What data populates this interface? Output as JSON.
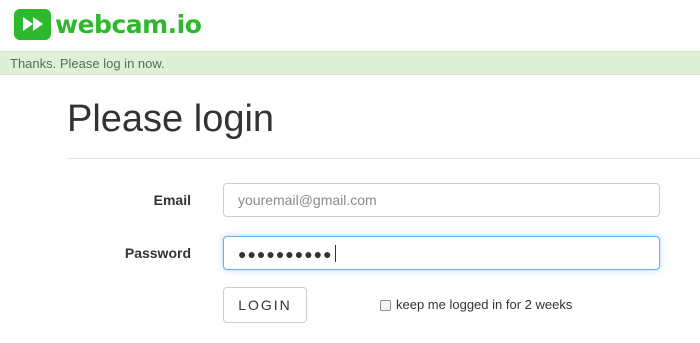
{
  "header": {
    "logo_text": "webcam.io",
    "logo_icon": "fast-forward-icon",
    "brand_color": "#2db82d"
  },
  "notice": {
    "text": "Thanks. Please log in now.",
    "background": "#dff0d8"
  },
  "main": {
    "title": "Please login"
  },
  "form": {
    "email": {
      "label": "Email",
      "value": "",
      "placeholder": "youremail@gmail.com"
    },
    "password": {
      "label": "Password",
      "value": "●●●●●●●●●●",
      "focused": true
    },
    "login_button": "LOGIN",
    "remember": {
      "label": "keep me logged in for 2 weeks",
      "checked": false
    }
  }
}
